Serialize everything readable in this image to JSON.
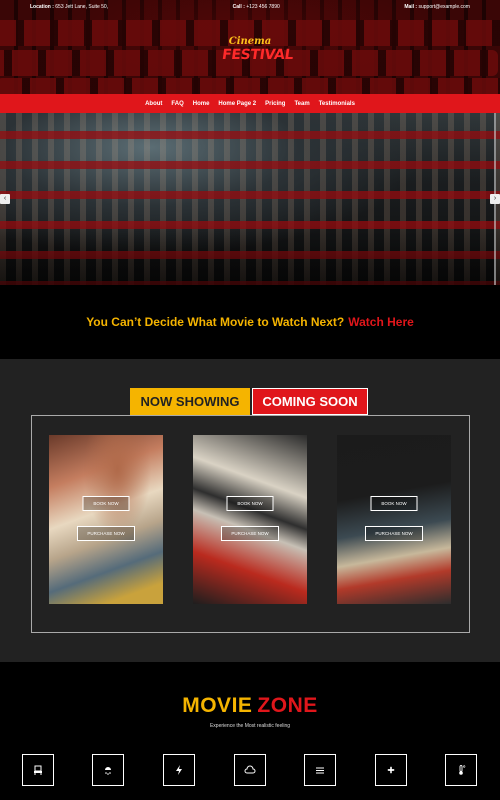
{
  "topbar": {
    "location_label": "Location :",
    "location_value": " 653 Jett Lane, Suite 50,",
    "call_label": "Call :",
    "call_value": " +123 456 7890",
    "mail_label": "Mail :",
    "mail_value": " support@example.com"
  },
  "logo": {
    "line1": "Cinema",
    "line2": "FESTIVAL"
  },
  "nav": {
    "items": [
      "About",
      "FAQ",
      "Home",
      "Home Page 2",
      "Pricing",
      "Team",
      "Testimonials"
    ]
  },
  "slider": {
    "prev_icon": "chevron-left-icon",
    "next_icon": "chevron-right-icon",
    "prev": "‹",
    "next": "›"
  },
  "tagline": {
    "question": "You Can’t Decide What Movie to Watch Next?",
    "link": "Watch Here"
  },
  "movies": {
    "tabs": {
      "now": "NOW SHOWING",
      "soon": "COMING SOON"
    },
    "book_label": "BOOK NOW",
    "purchase_label": "PURCHASE NOW"
  },
  "zone": {
    "title_a": "MOVIE",
    "title_b": "ZONE",
    "subtitle": "Experience the Most realistic feeling",
    "feature_icons": [
      "seat-icon",
      "snow-icon",
      "bolt-icon",
      "cloud-icon",
      "wind-icon",
      "fan-icon",
      "thermometer-icon"
    ]
  },
  "colors": {
    "red": "#e0161b",
    "yellow": "#f5b400",
    "dark": "#222222"
  }
}
